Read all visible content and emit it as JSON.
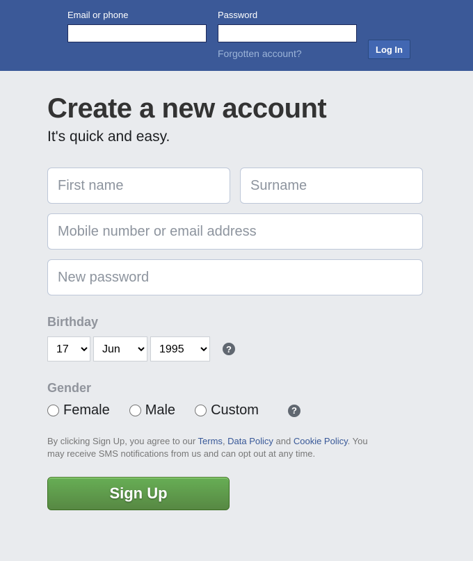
{
  "header": {
    "email_label": "Email or phone",
    "password_label": "Password",
    "login_button": "Log In",
    "forgotten_link": "Forgotten account?"
  },
  "main": {
    "title": "Create a new account",
    "subtitle": "It's quick and easy."
  },
  "form": {
    "first_name_placeholder": "First name",
    "surname_placeholder": "Surname",
    "contact_placeholder": "Mobile number or email address",
    "password_placeholder": "New password",
    "birthday_label": "Birthday",
    "birthday": {
      "day": "17",
      "month": "Jun",
      "year": "1995"
    },
    "gender_label": "Gender",
    "gender_options": {
      "female": "Female",
      "male": "Male",
      "custom": "Custom"
    },
    "help_glyph": "?",
    "terms": {
      "prefix": "By clicking Sign Up, you agree to our ",
      "terms_link": "Terms",
      "sep1": ", ",
      "data_link": "Data Policy",
      "sep2": " and ",
      "cookie_link": "Cookie Policy",
      "suffix": ". You may receive SMS notifications from us and can opt out at any time."
    },
    "signup_button": "Sign Up"
  }
}
